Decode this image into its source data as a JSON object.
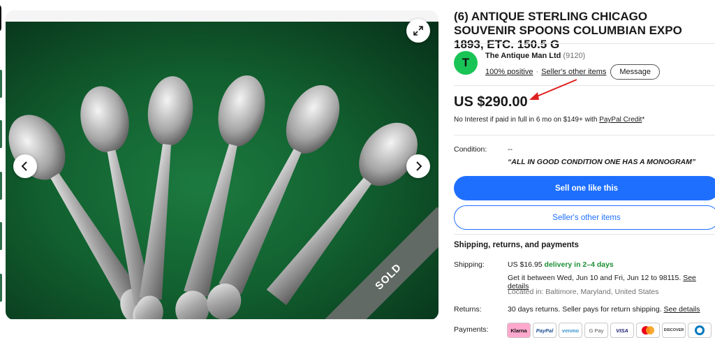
{
  "listing": {
    "title": "(6) ANTIQUE STERLING CHICAGO SOUVENIR SPOONS COLUMBIAN EXPO 1893, ETC. 150.5 G",
    "sold_ribbon": "SOLD"
  },
  "seller": {
    "avatar_letter": "T",
    "name": "The Antique Man Ltd",
    "score": "(9120)",
    "positive": "100% positive",
    "separator": "·",
    "other_items": "Seller's other items",
    "message_label": "Message"
  },
  "price": {
    "amount": "US $290.00",
    "credit_text": "No Interest if paid in full in 6 mo on $149+ with ",
    "credit_link": "PayPal Credit",
    "credit_suffix": "*"
  },
  "condition": {
    "label": "Condition:",
    "value": "--",
    "note": "“ALL IN GOOD CONDITION ONE HAS A MONOGRAM”"
  },
  "actions": {
    "sell_like_this": "Sell one like this",
    "sellers_other_items": "Seller's other items"
  },
  "shipping": {
    "section_title": "Shipping, returns, and payments",
    "label": "Shipping:",
    "cost": "US $16.95 ",
    "speed": "delivery in 2–4 days",
    "estimate": "Get it between Wed, Jun 10 and Fri, Jun 12 to 98115. ",
    "see_details": "See details",
    "location": "Located in: Baltimore, Maryland, United States"
  },
  "returns": {
    "label": "Returns:",
    "text": "30 days returns. Seller pays for return shipping. ",
    "see_details": "See details"
  },
  "payments": {
    "label": "Payments:",
    "methods": [
      "Klarna",
      "PayPal",
      "venmo",
      "G Pay",
      "VISA",
      "",
      "DISCOVER",
      ""
    ]
  },
  "colors": {
    "accent_blue": "#1f6fff",
    "green_delivery": "#1b8f34",
    "avatar_green": "#19c456",
    "arrow_red": "#e02020"
  },
  "icons": [
    "expand-icon",
    "chevron-left-icon",
    "chevron-right-icon",
    "red-arrow-annotation-icon"
  ]
}
